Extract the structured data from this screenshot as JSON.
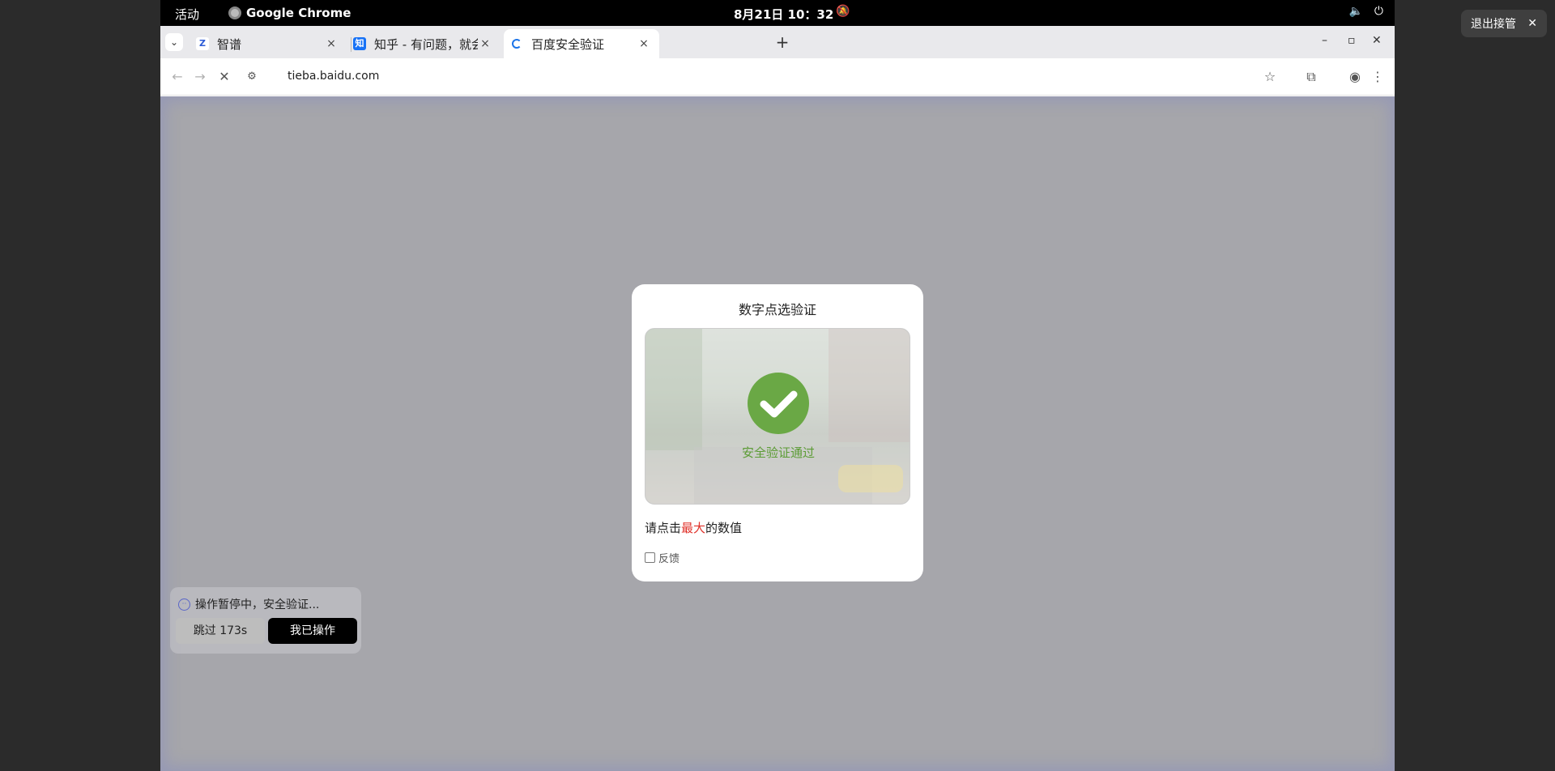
{
  "topbar": {
    "activities": "活动",
    "app_name": "Google Chrome",
    "clock": "8月21日  10：32",
    "bell_icon": "bell-muted-icon",
    "volume_icon": "volume-icon",
    "power_icon": "power-icon"
  },
  "exit_takeover": {
    "label": "退出接管",
    "close": "✕"
  },
  "tabs": [
    {
      "title": "智谱",
      "favicon": "Z",
      "favicon_color": "#ffffff",
      "favicon_text_color": "#2c5bd6",
      "close": "×"
    },
    {
      "title": "知乎 - 有问题，就会有答案",
      "favicon": "知",
      "favicon_color": "#1772f6",
      "favicon_text_color": "#ffffff",
      "close": "×"
    },
    {
      "title": "百度安全验证",
      "favicon": "",
      "favicon_color": "transparent",
      "favicon_text_color": "#1a73e8",
      "close": "×"
    }
  ],
  "tabstrip": {
    "new_tab": "+",
    "minimize": "–",
    "maximize": "▫",
    "close": "✕",
    "menu": "⌄"
  },
  "toolbar": {
    "back": "←",
    "forward": "→",
    "stop": "✕",
    "site_info": "⚙",
    "url": "tieba.baidu.com",
    "bookmark": "☆",
    "extensions": "⧉",
    "profile": "◉",
    "menu": "⋮"
  },
  "captcha": {
    "title": "数字点选验证",
    "passed_text": "安全验证通过",
    "instruction_pre": "请点击",
    "instruction_highlight": "最大",
    "instruction_post": "的数值",
    "feedback": "反馈",
    "success_color": "#6aa845"
  },
  "paused_panel": {
    "status": "操作暂停中，安全验证...",
    "skip_label": "跳过 173s",
    "done_label": "我已操作"
  }
}
